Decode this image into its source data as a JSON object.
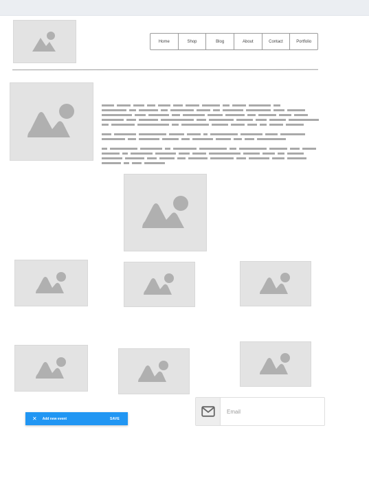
{
  "nav": {
    "items": [
      "Home",
      "Shop",
      "Blog",
      "About",
      "Contact",
      "Portfolio"
    ]
  },
  "images": {
    "icon_name": "image-placeholder-icon",
    "fill_color": "#e3e3e3",
    "glyph_color": "#b0b0b0"
  },
  "snackbar": {
    "text": "Add new event",
    "action": "SAVE",
    "close_icon": "close-icon",
    "color": "#2196f3"
  },
  "email": {
    "placeholder": "Email",
    "icon": "mail-icon"
  }
}
